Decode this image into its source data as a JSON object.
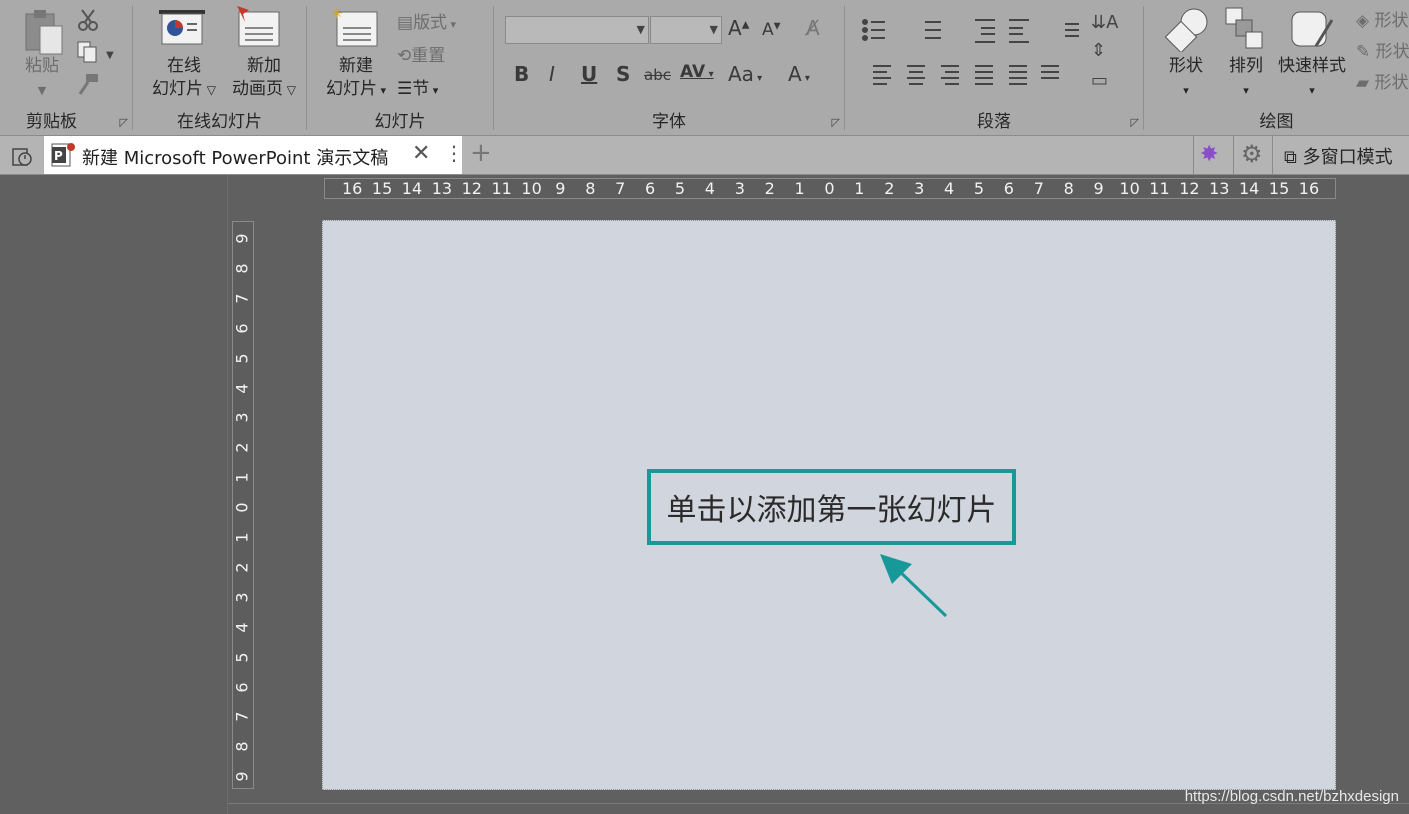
{
  "ribbon": {
    "clipboard": {
      "title": "剪贴板",
      "paste": "粘贴"
    },
    "online": {
      "title": "在线幻灯片",
      "online_slides_l1": "在线",
      "online_slides_l2": "幻灯片",
      "new_anim_l1": "新加",
      "new_anim_l2": "动画页"
    },
    "slides": {
      "title": "幻灯片",
      "new_slide_l1": "新建",
      "new_slide_l2": "幻灯片",
      "layout": "版式",
      "reset": "重置",
      "section": "节"
    },
    "font": {
      "title": "字体",
      "font_name": "",
      "font_size": "",
      "bold": "B",
      "italic": "I",
      "underline": "U",
      "shadow": "S",
      "strike": "abc",
      "spacing": "AV",
      "case": "Aa",
      "color": "A",
      "grow": "A",
      "shrink": "A"
    },
    "paragraph": {
      "title": "段落"
    },
    "drawing": {
      "title": "绘图",
      "shapes": "形状",
      "arrange": "排列",
      "quick_styles": "快速样式",
      "shape_fill": "形状",
      "shape_outline": "形状",
      "shape_effects": "形状"
    }
  },
  "tabbar": {
    "doc_title": "新建 Microsoft  PowerPoint 演示文稿",
    "multi_window": "多窗口模式"
  },
  "ruler_h_labels": [
    "16",
    "15",
    "14",
    "13",
    "12",
    "11",
    "10",
    "9",
    "8",
    "7",
    "6",
    "5",
    "4",
    "3",
    "2",
    "1",
    "0",
    "1",
    "2",
    "3",
    "4",
    "5",
    "6",
    "7",
    "8",
    "9",
    "10",
    "11",
    "12",
    "13",
    "14",
    "15",
    "16"
  ],
  "ruler_v_labels": [
    "9",
    "8",
    "7",
    "6",
    "5",
    "4",
    "3",
    "2",
    "1",
    "0",
    "1",
    "2",
    "3",
    "4",
    "5",
    "6",
    "7",
    "8",
    "9"
  ],
  "slide": {
    "hint": "单击以添加第一张幻灯片"
  },
  "watermark": "https://blog.csdn.net/bzhxdesign",
  "colors": {
    "accent": "#17999a",
    "ribbon_bg": "#aaaaaa",
    "slide_bg": "#d1d5de",
    "workspace_bg": "#606060"
  }
}
